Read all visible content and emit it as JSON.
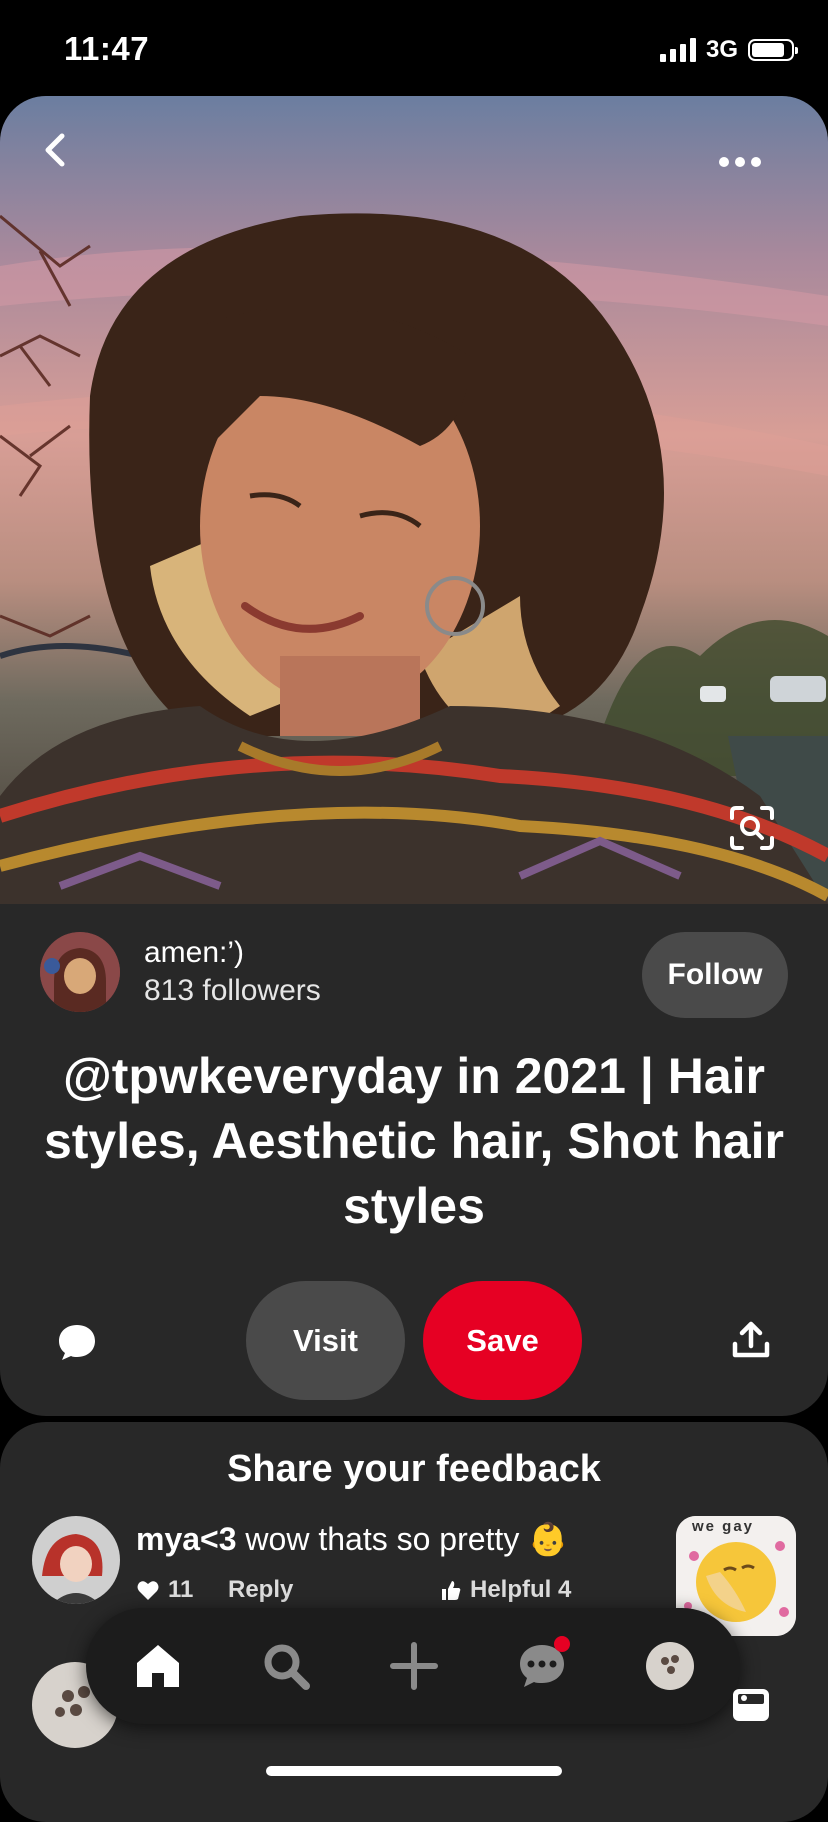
{
  "status_bar": {
    "time": "11:47",
    "network": "3G"
  },
  "pin": {
    "creator": {
      "name": "amen:’)",
      "followers": "813 followers",
      "follow_label": "Follow"
    },
    "title": "@tpwkeveryday in 2021 | Hair styles, Aesthetic hair, Shot hair styles",
    "actions": {
      "visit_label": "Visit",
      "save_label": "Save"
    }
  },
  "feedback": {
    "title": "Share your feedback",
    "comment": {
      "author": "mya<3",
      "text": "wow thats so pretty",
      "emoji": "👶",
      "likes": "11",
      "reply_label": "Reply",
      "helpful_label": "Helpful 4",
      "sticker_text": "we gay"
    }
  },
  "colors": {
    "accent": "#e60023",
    "card_bg": "#282828",
    "button_bg": "#4a4a4a"
  },
  "icons": [
    "back-icon",
    "more-icon",
    "visual-search-icon",
    "comment-icon",
    "share-icon",
    "heart-icon",
    "thumbs-up-icon",
    "home-icon",
    "search-icon",
    "plus-icon",
    "messages-icon",
    "gallery-icon"
  ]
}
